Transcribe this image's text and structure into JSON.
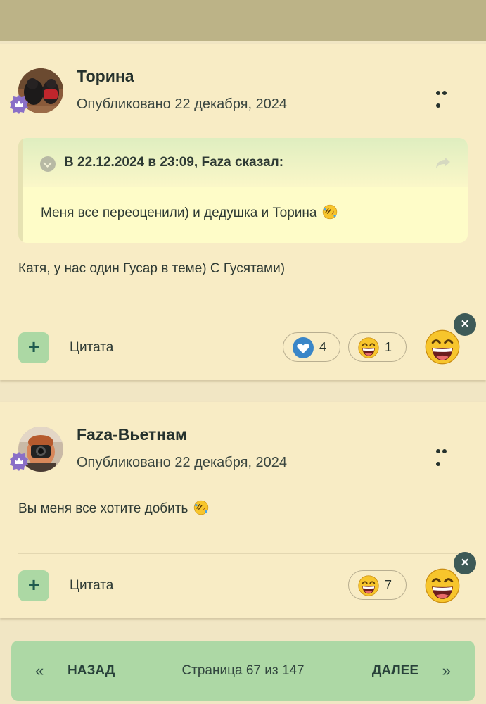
{
  "posts": [
    {
      "author": "Торина",
      "published": "Опубликовано 22 декабря, 2024",
      "quote": {
        "title": "В 22.12.2024 в 23:09, Faza сказал:",
        "text": "Меня все переоценили) и дедушка и Торина"
      },
      "body": "Катя, у нас один Гусар в теме) С Гусятами)",
      "quote_button": "Цитата",
      "reactions": [
        {
          "icon": "heart-icon",
          "count": "4"
        },
        {
          "icon": "laughing-face-icon",
          "count": "1"
        }
      ]
    },
    {
      "author": "Faza-Вьетнам",
      "published": "Опубликовано 22 декабря, 2024",
      "body": "Вы меня все хотите добить",
      "quote_button": "Цитата",
      "reactions": [
        {
          "icon": "laughing-face-icon",
          "count": "7"
        }
      ]
    }
  ],
  "pagination": {
    "prev_arrow": "«",
    "prev": "НАЗАД",
    "info": "Страница 67 из 147",
    "next": "ДАЛЕЕ",
    "next_arrow": "»"
  },
  "colors": {
    "background": "#f1e6c4",
    "card": "#f8ecc5",
    "accent_green": "#acd8a4",
    "topbar": "#bcb387"
  }
}
